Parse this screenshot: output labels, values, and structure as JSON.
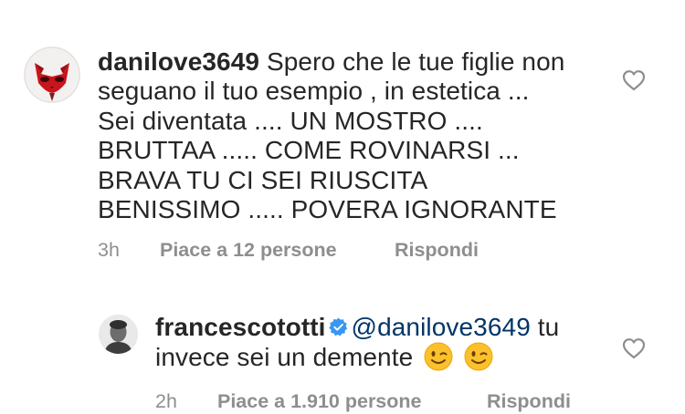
{
  "comments": [
    {
      "username": "danilove3649",
      "lines": [
        "Spero che le tue figlie non",
        "seguano il tuo esempio , in estetica ...",
        "Sei diventata .... UN MOSTRO ....",
        "BRUTTAA ..... COME ROVINARSI ...",
        "BRAVA TU CI SEI RIUSCITA",
        "BENISSIMO ..... POVERA IGNORANTE"
      ],
      "time": "3h",
      "likes": "Piace a 12 persone",
      "reply": "Rispondi",
      "avatar_icon": "red-cat-mask-avatar"
    },
    {
      "username": "francescototti",
      "verified": true,
      "mention": "@danilove3649",
      "text_after_mention": "tu",
      "line2": "invece sei un demente",
      "emojis": [
        "winking-face-emoji",
        "winking-face-emoji"
      ],
      "time": "2h",
      "likes": "Piace a 1.910 persone",
      "reply": "Rispondi",
      "avatar_icon": "profile-photo-avatar"
    }
  ],
  "colors": {
    "text": "#262626",
    "meta": "#8e8e8e",
    "mention": "#003569",
    "verified": "#3897f0",
    "avatar_mask": "#c8151b"
  }
}
